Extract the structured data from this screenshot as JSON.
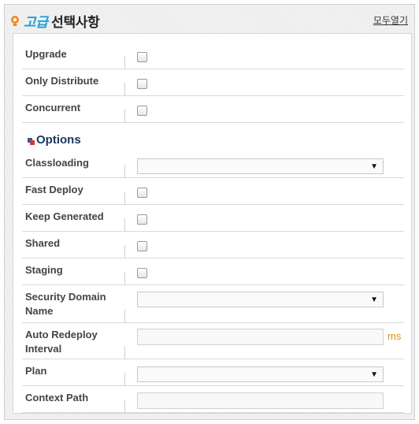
{
  "header": {
    "title_accent": "고급",
    "title_main": "선택사항",
    "expand_all": "모두열기"
  },
  "general_fields": [
    {
      "label": "Upgrade",
      "type": "checkbox"
    },
    {
      "label": "Only Distribute",
      "type": "checkbox"
    },
    {
      "label": "Concurrent",
      "type": "checkbox"
    }
  ],
  "options": {
    "title": "Options",
    "fields": [
      {
        "label": "Classloading",
        "type": "select",
        "value": ""
      },
      {
        "label": "Fast Deploy",
        "type": "checkbox"
      },
      {
        "label": "Keep Generated",
        "type": "checkbox"
      },
      {
        "label": "Shared",
        "type": "checkbox"
      },
      {
        "label": "Staging",
        "type": "checkbox"
      },
      {
        "label": "Security Domain Name",
        "type": "select",
        "value": ""
      },
      {
        "label": "Auto Redeploy Interval",
        "type": "text",
        "value": "",
        "unit": "ms"
      },
      {
        "label": "Plan",
        "type": "select",
        "value": ""
      },
      {
        "label": "Context Path",
        "type": "text",
        "value": ""
      }
    ]
  },
  "icons": {
    "title_icon": "bulb-icon",
    "options_icon": "squares-icon",
    "dropdown_icon": "triangle-down-icon"
  },
  "colors": {
    "accent": "#1e9fd6",
    "options_title": "#17375e",
    "unit": "#e08a1e"
  }
}
